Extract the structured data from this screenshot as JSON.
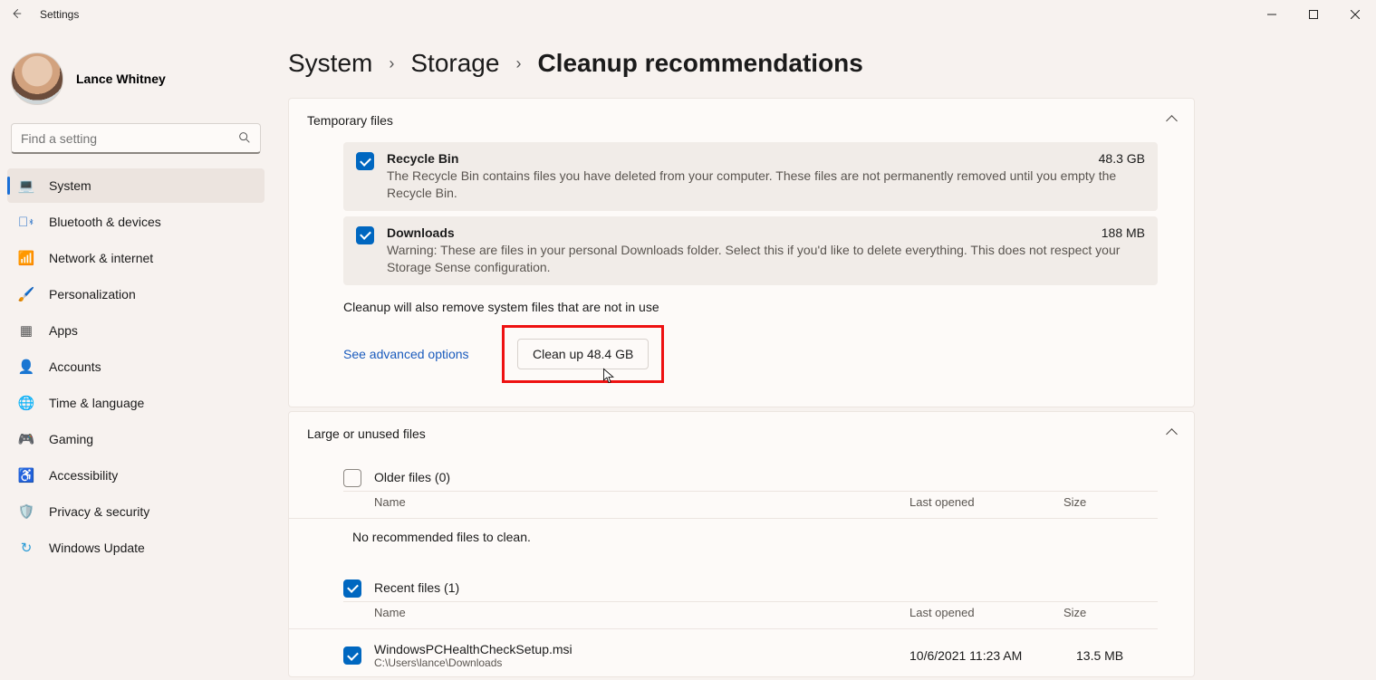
{
  "titlebar": {
    "title": "Settings"
  },
  "user": {
    "name": "Lance Whitney"
  },
  "search": {
    "placeholder": "Find a setting"
  },
  "nav": [
    {
      "label": "System"
    },
    {
      "label": "Bluetooth & devices"
    },
    {
      "label": "Network & internet"
    },
    {
      "label": "Personalization"
    },
    {
      "label": "Apps"
    },
    {
      "label": "Accounts"
    },
    {
      "label": "Time & language"
    },
    {
      "label": "Gaming"
    },
    {
      "label": "Accessibility"
    },
    {
      "label": "Privacy & security"
    },
    {
      "label": "Windows Update"
    }
  ],
  "breadcrumb": {
    "a": "System",
    "b": "Storage",
    "c": "Cleanup recommendations"
  },
  "temp": {
    "header": "Temporary files",
    "recycle": {
      "title": "Recycle Bin",
      "size": "48.3 GB",
      "desc": "The Recycle Bin contains files you have deleted from your computer. These files are not permanently removed until you empty the Recycle Bin."
    },
    "downloads": {
      "title": "Downloads",
      "size": "188 MB",
      "desc": "Warning: These are files in your personal Downloads folder. Select this if you'd like to delete everything. This does not respect your Storage Sense configuration."
    },
    "note": "Cleanup will also remove system files that are not in use",
    "advanced": "See advanced options",
    "button": "Clean up 48.4 GB"
  },
  "large": {
    "header": "Large or unused files",
    "older_label": "Older files (0)",
    "cols": {
      "name": "Name",
      "opened": "Last opened",
      "size": "Size"
    },
    "none": "No recommended files to clean.",
    "recent_label": "Recent files (1)",
    "file": {
      "name": "WindowsPCHealthCheckSetup.msi",
      "path": "C:\\Users\\lance\\Downloads",
      "opened": "10/6/2021 11:23 AM",
      "size": "13.5 MB"
    }
  }
}
